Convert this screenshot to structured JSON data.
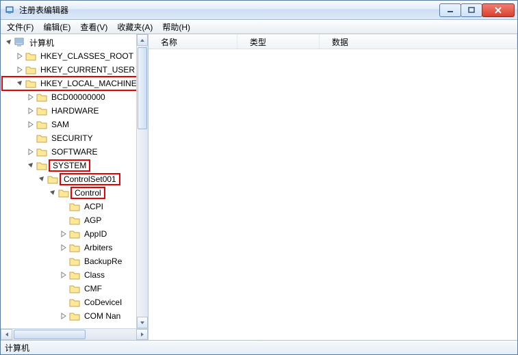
{
  "window": {
    "title": "注册表编辑器"
  },
  "menu": {
    "file": "文件(F)",
    "edit": "编辑(E)",
    "view": "查看(V)",
    "favorites": "收藏夹(A)",
    "help": "帮助(H)"
  },
  "tree": {
    "root": "计算机",
    "hkcr": "HKEY_CLASSES_ROOT",
    "hkcu": "HKEY_CURRENT_USER",
    "hklm": "HKEY_LOCAL_MACHINE",
    "bcd": "BCD00000000",
    "hardware": "HARDWARE",
    "sam": "SAM",
    "security": "SECURITY",
    "software": "SOFTWARE",
    "system": "SYSTEM",
    "cs001": "ControlSet001",
    "control": "Control",
    "acpi": "ACPI",
    "agp": "AGP",
    "appid": "AppID",
    "arbiters": "Arbiters",
    "backupre": "BackupRe",
    "class": "Class",
    "cmf": "CMF",
    "codevicei": "CoDeviceI",
    "comnan": "COM Nan"
  },
  "list": {
    "col_name": "名称",
    "col_type": "类型",
    "col_data": "数据"
  },
  "status": {
    "path": "计算机"
  }
}
